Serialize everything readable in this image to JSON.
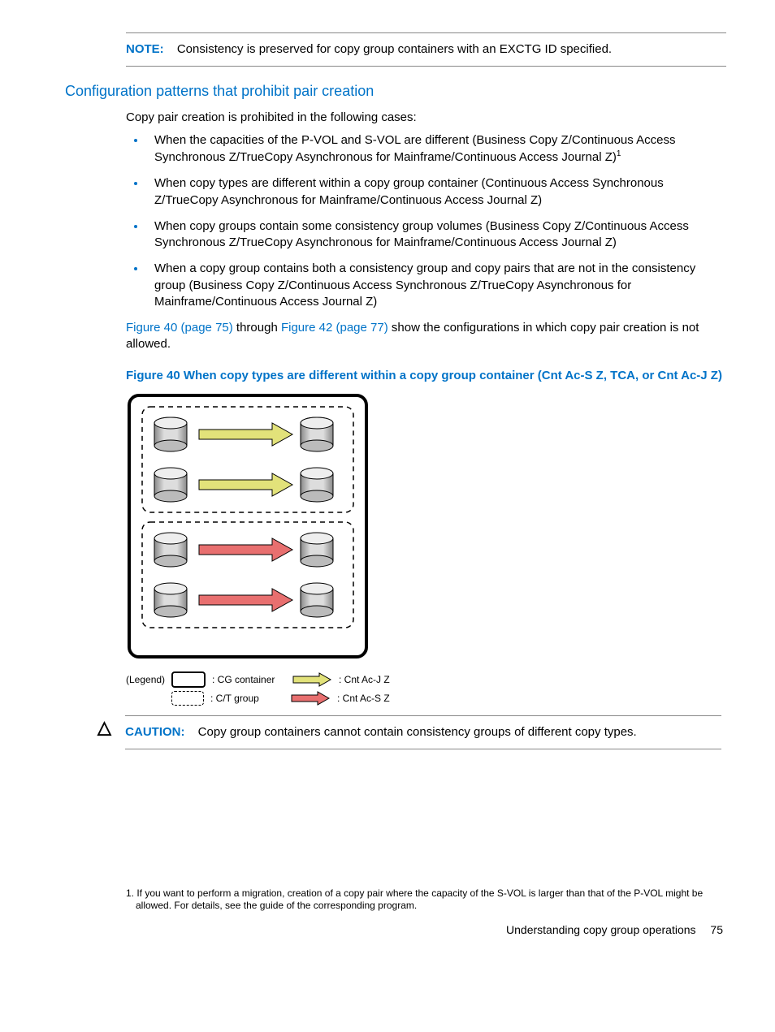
{
  "note": {
    "label": "NOTE:",
    "text": "Consistency is preserved for copy group containers with an EXCTG ID specified."
  },
  "section_heading": "Configuration patterns that prohibit pair creation",
  "intro": "Copy pair creation is prohibited in the following cases:",
  "bullets": [
    "When the capacities of the P-VOL and S-VOL are different (Business Copy Z/Continuous Access Synchronous Z/TrueCopy Asynchronous for Mainframe/Continuous Access Journal Z)",
    "When copy types are different within a copy group container (Continuous Access Synchronous Z/TrueCopy Asynchronous for Mainframe/Continuous Access Journal Z)",
    "When copy groups contain some consistency group volumes (Business Copy Z/Continuous Access Synchronous Z/TrueCopy Asynchronous for Mainframe/Continuous Access Journal Z)",
    "When a copy group contains both a consistency group and copy pairs that are not in the consistency group (Business Copy Z/Continuous Access Synchronous Z/TrueCopy Asynchronous for Mainframe/Continuous Access Journal Z)"
  ],
  "bullet1_sup": "1",
  "para_links": {
    "link1": "Figure 40 (page 75)",
    "mid": " through ",
    "link2": "Figure 42 (page 77)",
    "tail": " show the configurations in which copy pair creation is not allowed."
  },
  "figure_caption": "Figure 40 When copy types are different within a copy group container (Cnt Ac-S Z, TCA, or Cnt Ac-J Z)",
  "legend": {
    "label": "(Legend)",
    "cg": ": CG container",
    "ct": ": C/T group",
    "acj": ": Cnt Ac-J Z",
    "acs": ": Cnt Ac-S Z"
  },
  "caution": {
    "label": "CAUTION:",
    "text": "Copy group containers cannot contain consistency groups of different copy types."
  },
  "footnote": "1.  If you want to perform a migration, creation of a copy pair where the capacity of the S-VOL is larger than that of the P-VOL might be allowed. For details, see the guide of the corresponding program.",
  "footer_text": "Understanding copy group operations",
  "page_number": "75"
}
